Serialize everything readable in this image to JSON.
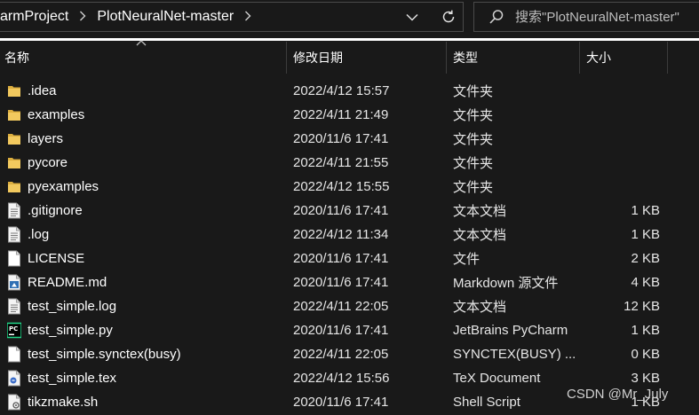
{
  "breadcrumb": {
    "items": [
      "armProject",
      "PlotNeuralNet-master"
    ]
  },
  "search": {
    "placeholder": "搜索\"PlotNeuralNet-master\""
  },
  "columns": {
    "name": "名称",
    "date": "修改日期",
    "type": "类型",
    "size": "大小"
  },
  "files": [
    {
      "name": ".idea",
      "date": "2022/4/12 15:57",
      "type": "文件夹",
      "size": "",
      "icon": "folder-icon"
    },
    {
      "name": "examples",
      "date": "2022/4/11 21:49",
      "type": "文件夹",
      "size": "",
      "icon": "folder-icon"
    },
    {
      "name": "layers",
      "date": "2020/11/6 17:41",
      "type": "文件夹",
      "size": "",
      "icon": "folder-icon"
    },
    {
      "name": "pycore",
      "date": "2022/4/11 21:55",
      "type": "文件夹",
      "size": "",
      "icon": "folder-icon"
    },
    {
      "name": "pyexamples",
      "date": "2022/4/12 15:55",
      "type": "文件夹",
      "size": "",
      "icon": "folder-icon"
    },
    {
      "name": ".gitignore",
      "date": "2020/11/6 17:41",
      "type": "文本文档",
      "size": "1 KB",
      "icon": "text-file-icon"
    },
    {
      "name": ".log",
      "date": "2022/4/12 11:34",
      "type": "文本文档",
      "size": "1 KB",
      "icon": "text-file-icon"
    },
    {
      "name": "LICENSE",
      "date": "2020/11/6 17:41",
      "type": "文件",
      "size": "2 KB",
      "icon": "blank-file-icon"
    },
    {
      "name": "README.md",
      "date": "2020/11/6 17:41",
      "type": "Markdown 源文件",
      "size": "4 KB",
      "icon": "markdown-file-icon"
    },
    {
      "name": "test_simple.log",
      "date": "2022/4/11 22:05",
      "type": "文本文档",
      "size": "12 KB",
      "icon": "text-file-icon"
    },
    {
      "name": "test_simple.py",
      "date": "2020/11/6 17:41",
      "type": "JetBrains PyCharm",
      "size": "1 KB",
      "icon": "pycharm-file-icon"
    },
    {
      "name": "test_simple.synctex(busy)",
      "date": "2022/4/11 22:05",
      "type": "SYNCTEX(BUSY) ...",
      "size": "0 KB",
      "icon": "blank-file-icon"
    },
    {
      "name": "test_simple.tex",
      "date": "2022/4/12 15:56",
      "type": "TeX Document",
      "size": "3 KB",
      "icon": "tex-file-icon"
    },
    {
      "name": "tikzmake.sh",
      "date": "2020/11/6 17:41",
      "type": "Shell Script",
      "size": "1 KB",
      "icon": "shell-script-icon"
    }
  ],
  "icons": {
    "dropdown": "chevron-down-icon",
    "refresh": "refresh-icon",
    "search": "search-icon",
    "separator": "chevron-right-icon",
    "sort": "sort-up-icon"
  },
  "colors": {
    "background": "#191919",
    "folder": "#f2c95e",
    "text": "#ffffff"
  },
  "watermark": "CSDN @Mr_July"
}
